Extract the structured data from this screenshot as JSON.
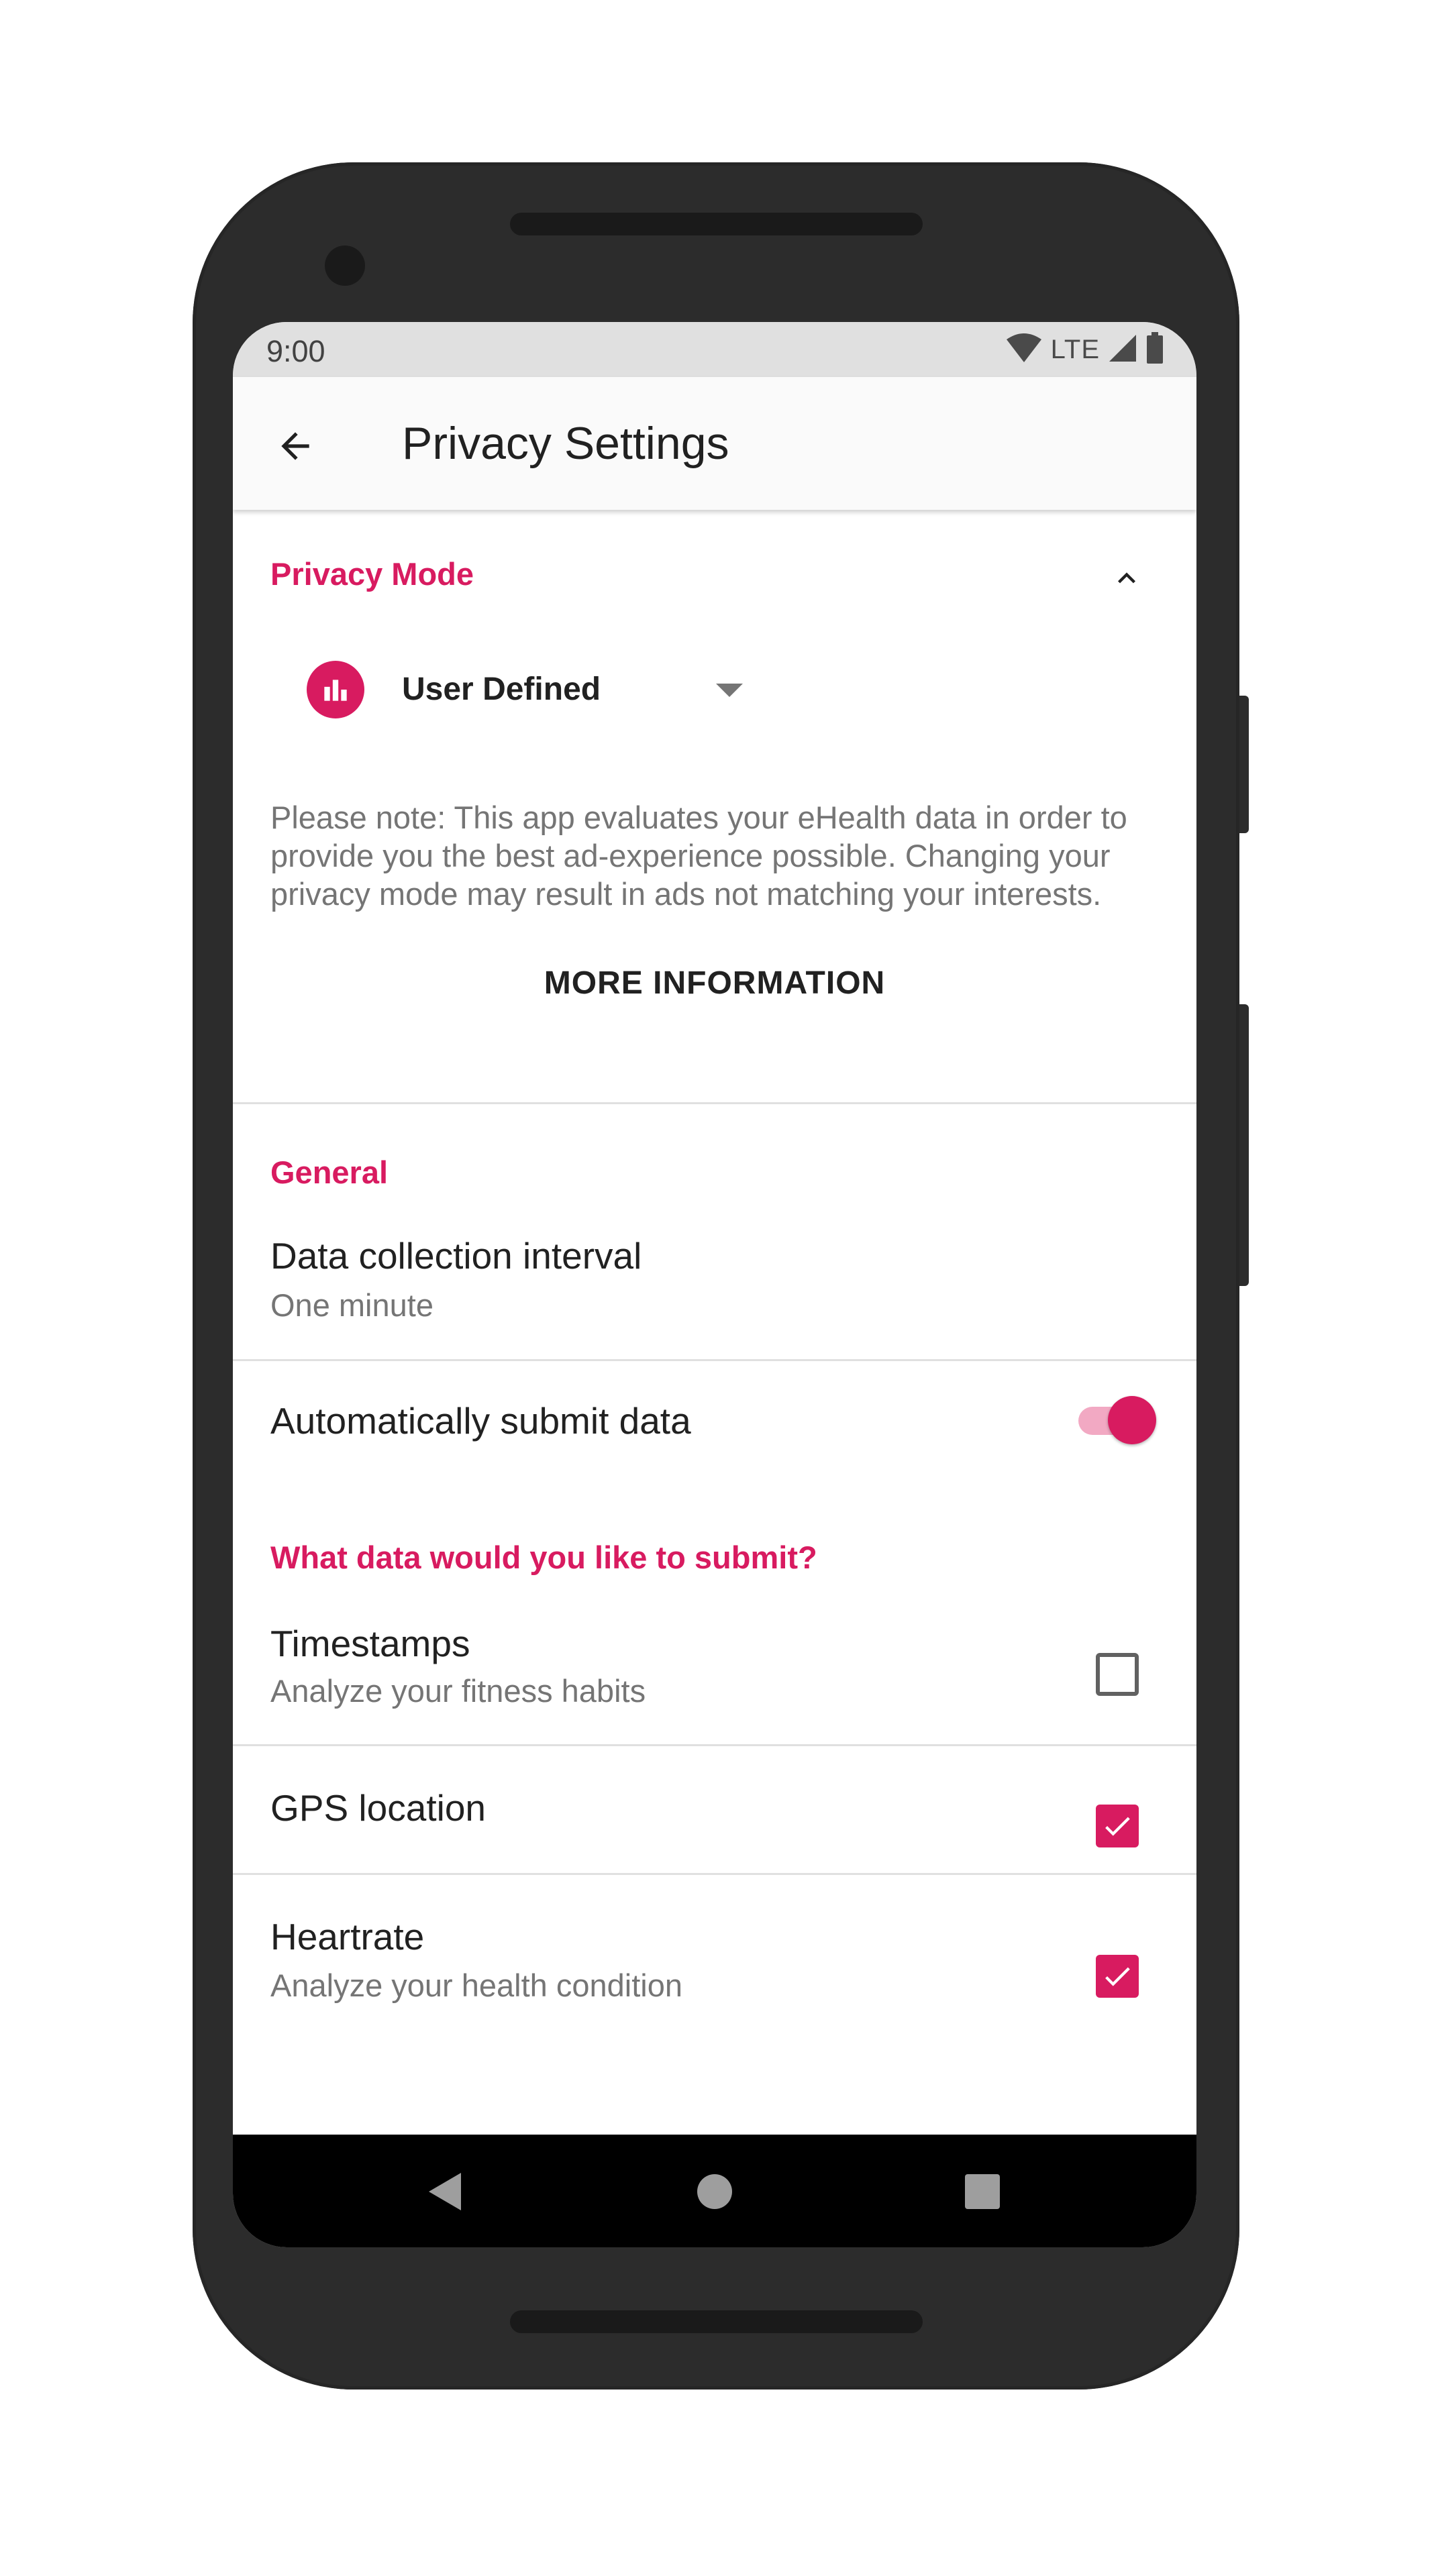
{
  "status_bar": {
    "time": "9:00",
    "network": "LTE",
    "icons": [
      "wifi-icon",
      "cell-signal-icon",
      "battery-icon"
    ]
  },
  "app_bar": {
    "back_icon": "arrow-left-icon",
    "title": "Privacy Settings"
  },
  "privacy_mode": {
    "section_title": "Privacy Mode",
    "collapse_icon": "chevron-up-icon",
    "mode_icon": "bar-chart-icon",
    "selected_mode": "User Defined",
    "dropdown_icon": "dropdown-arrow-icon",
    "note": "Please note: This app evaluates your eHealth data in order to provide you the best ad-experience possible. Changing your privacy mode may result in ads not matching your interests.",
    "more_info_label": "MORE INFORMATION"
  },
  "general": {
    "section_title": "General",
    "interval_title": "Data collection interval",
    "interval_value": "One minute",
    "auto_submit_label": "Automatically submit data",
    "auto_submit_on": true
  },
  "submit_data": {
    "section_title": "What data would you like to submit?",
    "items": [
      {
        "title": "Timestamps",
        "subtitle": "Analyze your fitness habits",
        "checked": false
      },
      {
        "title": "GPS location",
        "subtitle": "",
        "checked": true
      },
      {
        "title": "Heartrate",
        "subtitle": "Analyze your health condition",
        "checked": true
      }
    ]
  },
  "nav_bar": {
    "icons": [
      "nav-back-icon",
      "nav-home-icon",
      "nav-recents-icon"
    ]
  },
  "colors": {
    "accent": "#d81b60",
    "accent_light": "#f2a9c3",
    "frame": "#2c2c2c",
    "status_bar": "#e0e0e0",
    "text_primary": "#212121",
    "text_secondary": "#757575"
  }
}
